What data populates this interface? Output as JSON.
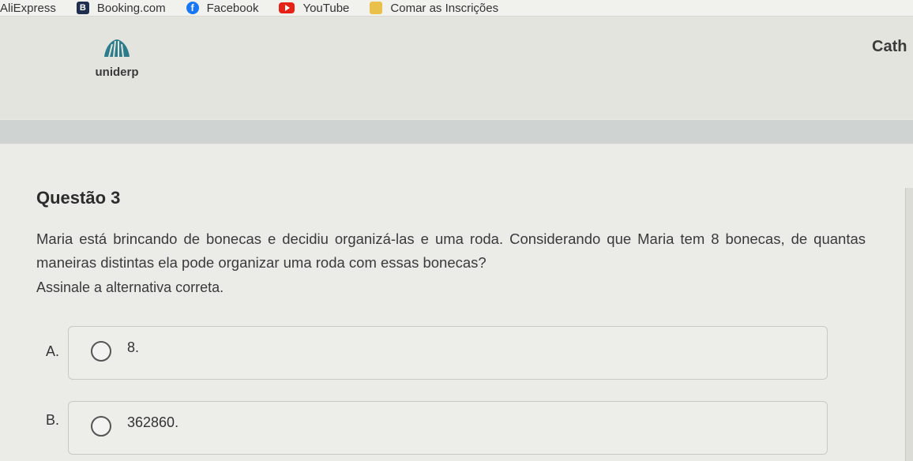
{
  "bookmarks": [
    {
      "label": "AliExpress",
      "icon": "none"
    },
    {
      "label": "Booking.com",
      "icon": "booking-icon"
    },
    {
      "label": "Facebook",
      "icon": "facebook-icon"
    },
    {
      "label": "YouTube",
      "icon": "youtube-icon"
    },
    {
      "label": "Comar as Inscrições",
      "icon": "sheet-icon"
    }
  ],
  "header": {
    "logo_text": "uniderp",
    "user_name": "Cath"
  },
  "question": {
    "title": "Questão 3",
    "text": "Maria está brincando de bonecas e decidiu organizá-las e uma roda. Considerando que Maria tem 8 bonecas, de quantas maneiras distintas ela pode organizar uma roda com essas bonecas?",
    "instruction": "Assinale a alternativa correta.",
    "options": [
      {
        "letter": "A.",
        "value": "8."
      },
      {
        "letter": "B.",
        "value": "362860."
      }
    ]
  },
  "colors": {
    "background": "#e9e9e4",
    "header_bar": "#cfd3d1",
    "logo_teal": "#2c7c8c"
  }
}
